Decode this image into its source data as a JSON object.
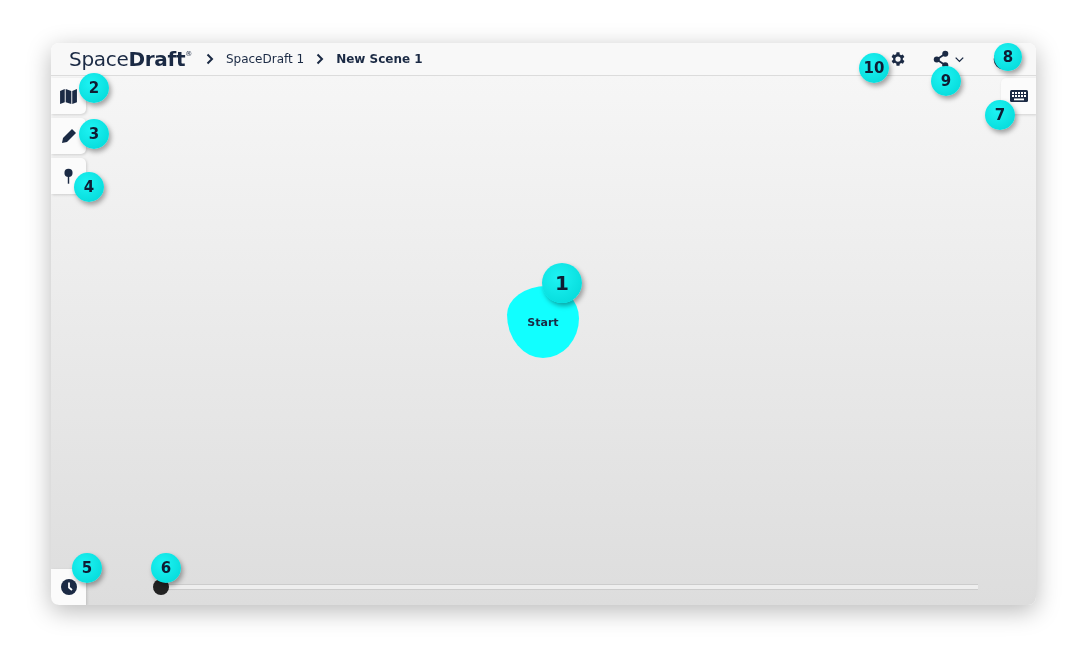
{
  "header": {
    "logo": "Space**Draft**$^{®}$",
    "breadcrumbs": [
      {
        "label": "SpaceDraft 1",
        "current": false
      },
      {
        "label": "New Scene 1",
        "current": true
      }
    ]
  },
  "left_tools": [
    {
      "kind": "map"
    },
    {
      "kind": "pencil"
    },
    {
      "kind": "pin"
    }
  ],
  "start_button": {
    "label": "Start"
  },
  "timeline": {
    "level": 0
  },
  "callouts": [
    {
      "label": "1"
    },
    {
      "label": "2"
    },
    {
      "label": "3"
    },
    {
      "label": "4"
    },
    {
      "label": "5"
    },
    {
      "label": "6"
    },
    {
      "label": "7"
    },
    {
      "label": "8"
    },
    {
      "label": "9"
    },
    {
      "label": "10"
    }
  ]
}
